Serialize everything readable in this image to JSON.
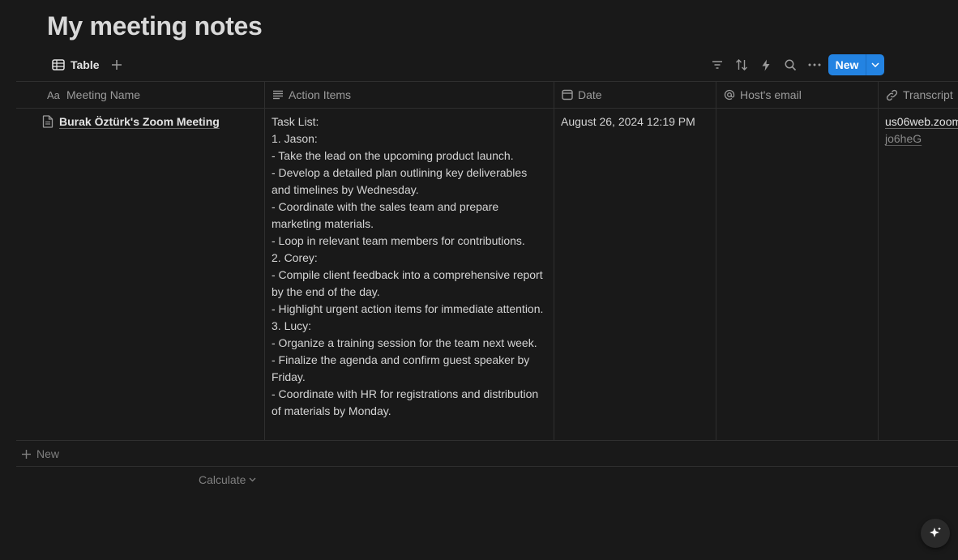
{
  "page": {
    "title": "My meeting notes"
  },
  "views": {
    "tab_table_label": "Table"
  },
  "toolbar": {
    "new_label": "New"
  },
  "columns": [
    {
      "label": "Meeting Name",
      "icon": "title-icon"
    },
    {
      "label": "Action Items",
      "icon": "text-lines-icon"
    },
    {
      "label": "Date",
      "icon": "calendar-icon"
    },
    {
      "label": "Host's email",
      "icon": "at-icon"
    },
    {
      "label": "Transcript",
      "icon": "link-icon"
    }
  ],
  "rows": [
    {
      "name": "Burak Öztürk's Zoom Meeting",
      "action_items": "Task List:\n1. Jason:\n- Take the lead on the upcoming product launch.\n- Develop a detailed plan outlining key deliverables and timelines by Wednesday.\n- Coordinate with the sales team and prepare marketing materials.\n- Loop in relevant team members for contributions.\n2. Corey:\n- Compile client feedback into a comprehensive report by the end of the day.\n- Highlight urgent action items for immediate attention.\n3. Lucy:\n- Organize a training session for the team next week.\n- Finalize the agenda and confirm guest speaker by Friday.\n- Coordinate with HR for registrations and distribution of materials by Monday.",
      "date": "August 26, 2024 12:19 PM",
      "host_email": "",
      "transcript_line1": "us06web.zoom",
      "transcript_line2": "jo6heG"
    }
  ],
  "footer": {
    "new_row_label": "New",
    "calculate_label": "Calculate"
  },
  "colors": {
    "background": "#191919",
    "accent": "#2383e2",
    "text": "#d4d4d4",
    "muted": "#9b9b9b"
  }
}
